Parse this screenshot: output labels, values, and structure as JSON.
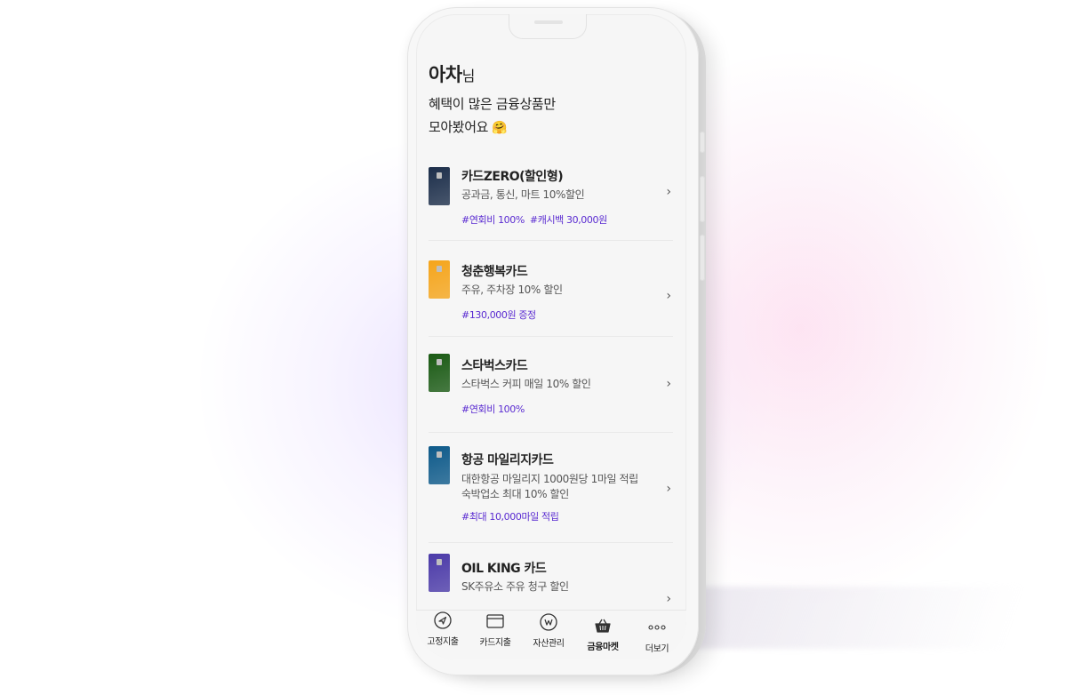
{
  "app": {
    "user_name": "아차",
    "name_suffix": "님",
    "headline_line1": "혜택이 많은 금융상품만",
    "headline_line2": "모아봤어요",
    "headline_emoji": "🤗"
  },
  "cards": [
    {
      "title": "카드ZERO(할인형)",
      "desc": [
        "공과금, 통신, 마트 10%할인"
      ],
      "tags": [
        "#연회비 100%",
        "#캐시백 30,000원"
      ],
      "color": "#1c2e4a"
    },
    {
      "title": "청춘행복카드",
      "desc": [
        "주유, 주차장 10% 할인"
      ],
      "tags": [
        "#130,000원 증정"
      ],
      "color": "#f5a51c"
    },
    {
      "title": "스타벅스카드",
      "desc": [
        "스타벅스 커피 매일 10% 할인"
      ],
      "tags": [
        "#연회비 100%"
      ],
      "color": "#1a5a14"
    },
    {
      "title": "항공 마일리지카드",
      "desc": [
        "대한항공 마일리지 1000원당 1마일 적립",
        "숙박업소 최대 10% 할인"
      ],
      "tags": [
        "#최대 10,000마일 적립"
      ],
      "color": "#0e5a8a"
    },
    {
      "title": "OIL KING 카드",
      "desc": [
        "SK주유소 주유 청구 할인"
      ],
      "tags": [],
      "color": "#4b3aa8"
    }
  ],
  "tabbar": [
    {
      "label": "고정지출",
      "icon": "send-icon"
    },
    {
      "label": "카드지출",
      "icon": "card-icon"
    },
    {
      "label": "자산관리",
      "icon": "won-coin-icon"
    },
    {
      "label": "금융마켓",
      "icon": "basket-icon",
      "active": true
    },
    {
      "label": "더보기",
      "icon": "more-icon"
    }
  ],
  "colors": {
    "accent": "#5a2bd1",
    "text": "#222222"
  }
}
